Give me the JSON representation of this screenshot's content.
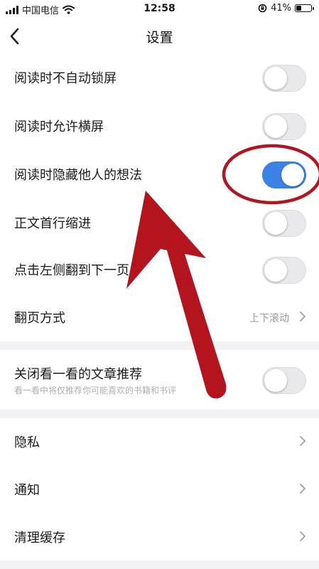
{
  "status_bar": {
    "carrier": "中国电信",
    "time": "12:58",
    "battery": "41%",
    "battery_level": 0.41
  },
  "nav": {
    "title": "设置"
  },
  "settings": [
    {
      "label": "阅读时不自动锁屏",
      "on": false
    },
    {
      "label": "阅读时允许横屏",
      "on": false
    },
    {
      "label": "阅读时隐藏他人的想法",
      "on": true
    },
    {
      "label": "正文首行缩进",
      "on": false
    },
    {
      "label": "点击左侧翻到下一页",
      "on": false
    }
  ],
  "page_turn": {
    "label": "翻页方式",
    "value": "上下滚动"
  },
  "recommend": {
    "label": "关闭看一看的文章推荐",
    "sub": "看一看中将仅推荐你可能喜欢的书籍和书评",
    "on": false
  },
  "links": [
    {
      "label": "隐私"
    },
    {
      "label": "通知"
    },
    {
      "label": "清理缓存"
    }
  ],
  "colors": {
    "accent": "#3b82e6",
    "annotation": "#b3141e"
  }
}
